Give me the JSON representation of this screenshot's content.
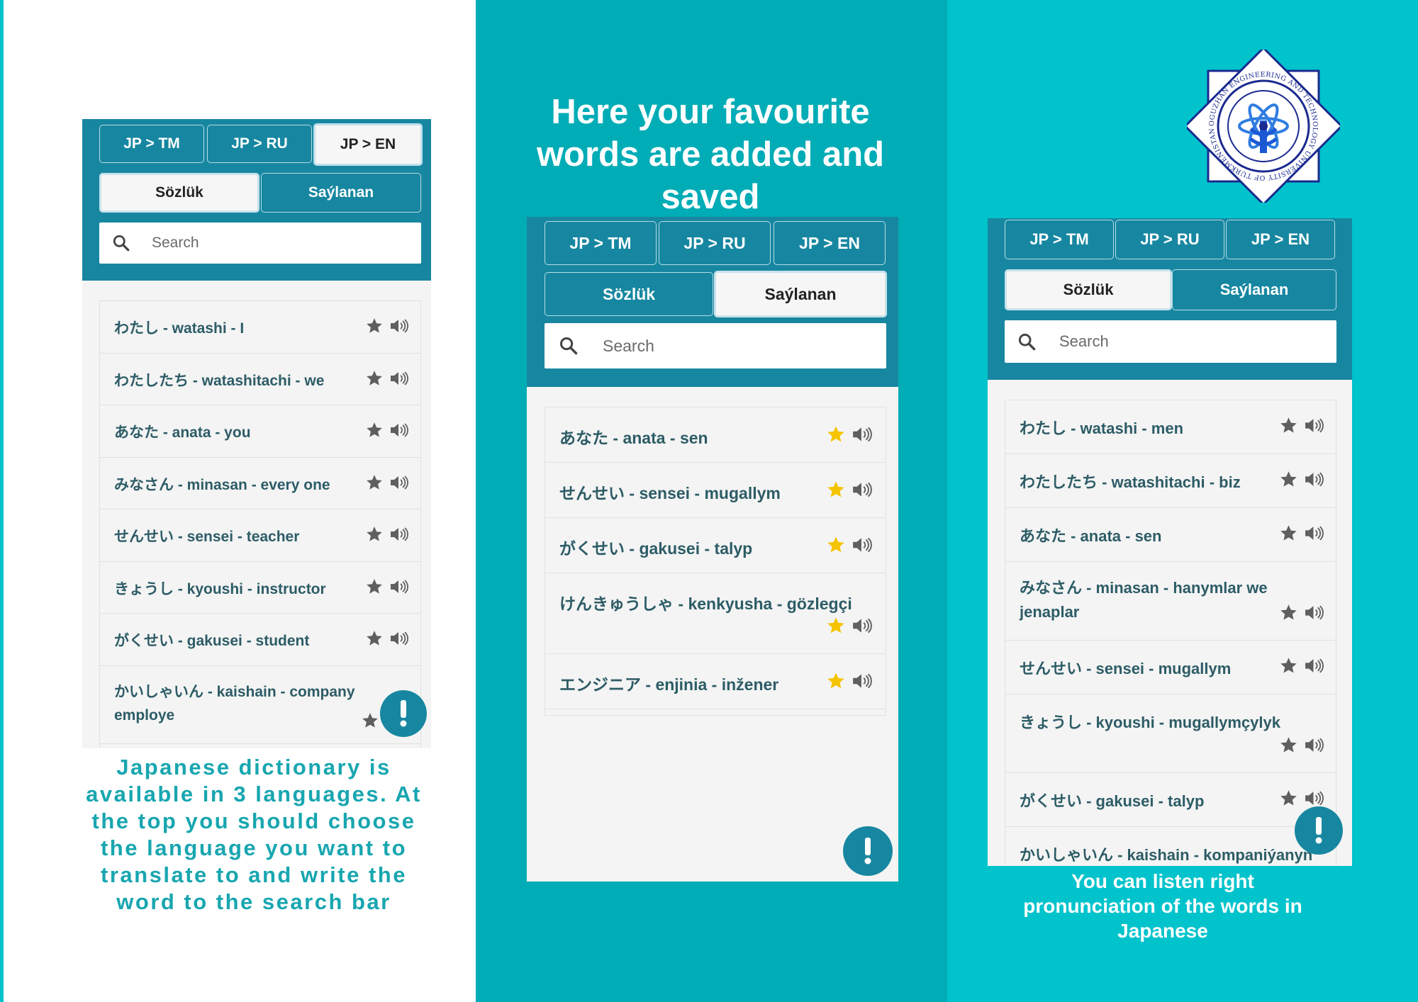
{
  "lang_tabs": [
    "JP > TM",
    "JP > RU",
    "JP > EN"
  ],
  "mode_tabs": [
    "Sözlük",
    "Saýlanan"
  ],
  "search_placeholder": "Search",
  "panel_left": {
    "active_lang": 2,
    "active_mode": 0,
    "words": [
      "わたし - watashi - I",
      "わたしたち - watashitachi - we",
      "あなた - anata - you",
      "みなさん - minasan - every one",
      "せんせい - sensei - teacher",
      "きょうし - kyoushi - instructor",
      "がくせい - gakusei - student",
      "かいしゃいん - kaishain - company employe"
    ],
    "caption": "Japanese dictionary is available in 3 languages. At the top you should choose the language you want to translate to and write the word to the search bar"
  },
  "panel_mid": {
    "active_mode": 1,
    "title": "Here your favourite words are added and saved",
    "words": [
      "あなた - anata - sen",
      "せんせい - sensei - mugallym",
      "がくせい - gakusei - talyp",
      "けんきゅうしゃ - kenkyusha - gözlegçi",
      "エンジニア - enjinia - inžener"
    ]
  },
  "panel_right": {
    "active_mode": 0,
    "words": [
      "わたし - watashi - men",
      "わたしたち - watashitachi - biz",
      "あなた - anata - sen",
      "みなさん - minasan - hanymlar we jenaplar",
      "せんせい - sensei - mugallym",
      "きょうし - kyoushi - mugallymçylyk",
      "がくせい - gakusei - talyp",
      "かいしゃいん - kaishain - kompaniýanyň"
    ],
    "caption": "You can listen right pronunciation of the words in Japanese",
    "logo_text": "OGUZHAN ENGINEERING AND TECHNOLOGY UNIVERSITY OF TURKMENISTAN"
  },
  "icons": {
    "star": "star-icon",
    "speaker": "speaker-icon",
    "search": "search-icon",
    "fab": "exclamation-icon"
  },
  "colors": {
    "header_blue": "#1787a1",
    "star_grey": "#5f5f5f",
    "star_gold": "#f5c400",
    "word_text": "#2d5c66",
    "teal_left": "#00c3cc",
    "teal_mid": "#00acb6",
    "caption_teal": "#18a6b0"
  }
}
